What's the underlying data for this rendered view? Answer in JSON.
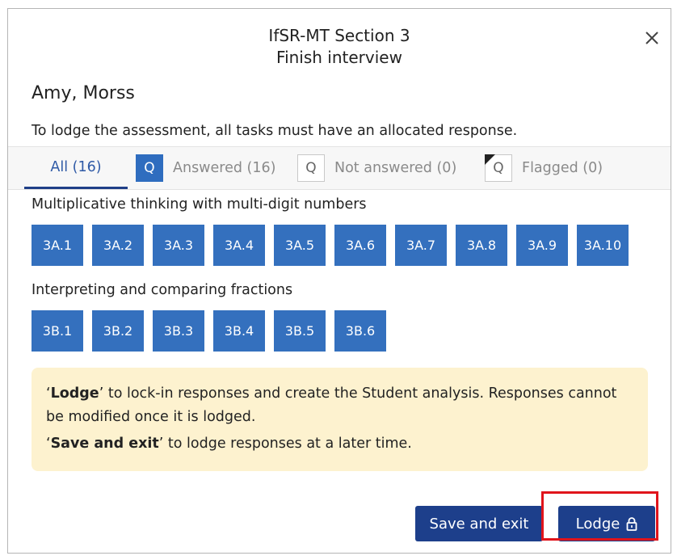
{
  "dialog": {
    "title_line1": "IfSR-MT Section 3",
    "title_line2": "Finish interview",
    "close_icon": "close-icon"
  },
  "student_name": "Amy, Morss",
  "instruction": "To lodge the assessment, all tasks must have an allocated response.",
  "tabs": {
    "all": "All (16)",
    "answered": "Answered (16)",
    "not_answered": "Not answered (0)",
    "flagged": "Flagged (0)",
    "badge_letter": "Q"
  },
  "groups": [
    {
      "title": "Multiplicative thinking with multi-digit numbers",
      "tasks": [
        "3A.1",
        "3A.2",
        "3A.3",
        "3A.4",
        "3A.5",
        "3A.6",
        "3A.7",
        "3A.8",
        "3A.9",
        "3A.10"
      ]
    },
    {
      "title": "Interpreting and comparing fractions",
      "tasks": [
        "3B.1",
        "3B.2",
        "3B.3",
        "3B.4",
        "3B.5",
        "3B.6"
      ]
    }
  ],
  "notice": {
    "lodge_bold": "Lodge",
    "lodge_text": " to lock-in responses and create the Student analysis. Responses cannot be modified once it is lodged.",
    "save_bold": "Save and exit",
    "save_text": " to lodge responses at a later time."
  },
  "buttons": {
    "save_and_exit": "Save and exit",
    "lodge": "Lodge"
  },
  "colors": {
    "primary": "#1d3f8b",
    "task_blue": "#3470be",
    "notice_bg": "#fdf2cf",
    "highlight": "#e0141b"
  }
}
